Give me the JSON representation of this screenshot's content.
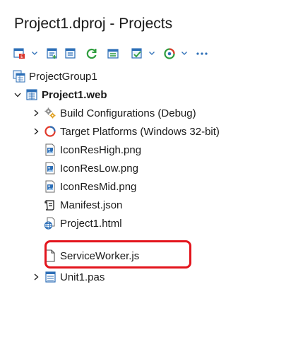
{
  "panel": {
    "title": "Project1.dproj - Projects"
  },
  "toolbar": {
    "buttons": [
      {
        "icon": "build-config-icon",
        "has_dropdown": true
      },
      {
        "icon": "add-file-icon",
        "has_dropdown": false
      },
      {
        "icon": "remove-file-icon",
        "has_dropdown": false
      },
      {
        "icon": "refresh-icon",
        "has_dropdown": false
      },
      {
        "icon": "sync-icon",
        "has_dropdown": false
      },
      {
        "icon": "compile-icon",
        "has_dropdown": true
      },
      {
        "icon": "run-target-icon",
        "has_dropdown": true
      },
      {
        "icon": "more-icon",
        "has_dropdown": false
      }
    ]
  },
  "tree": {
    "group": "ProjectGroup1",
    "project": "Project1.web",
    "build_configurations": "Build Configurations (Debug)",
    "target_platforms": "Target Platforms (Windows 32-bit)",
    "files": {
      "icon_res_high": "IconResHigh.png",
      "icon_res_low": "IconResLow.png",
      "icon_res_mid": "IconResMid.png",
      "manifest": "Manifest.json",
      "html": "Project1.html",
      "service_worker": "ServiceWorker.js",
      "unit": "Unit1.pas"
    }
  },
  "colors": {
    "highlight": "#e3141c",
    "accent_blue": "#2d6fb7",
    "target_red": "#e0392b",
    "refresh_green": "#2e9d3e"
  }
}
